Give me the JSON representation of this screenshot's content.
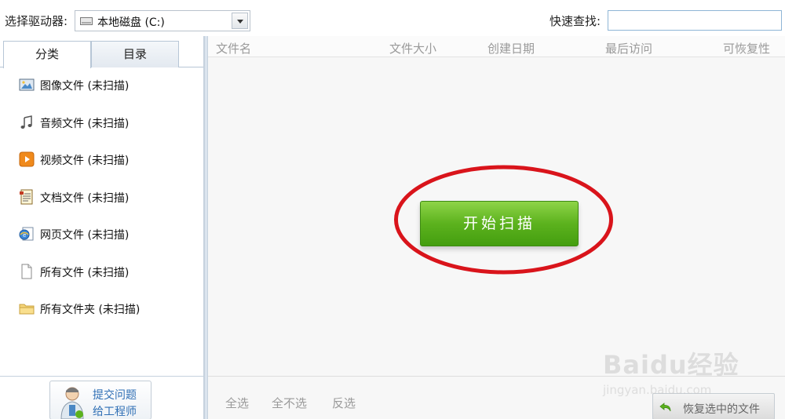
{
  "toolbar": {
    "drive_label": "选择驱动器:",
    "drive_value": "本地磁盘 (C:)",
    "search_label": "快速查找:",
    "search_value": ""
  },
  "tabs": [
    {
      "label": "分类",
      "active": true
    },
    {
      "label": "目录",
      "active": false
    }
  ],
  "categories": [
    {
      "label": "图像文件 (未扫描)",
      "icon": "image-icon"
    },
    {
      "label": "音频文件 (未扫描)",
      "icon": "music-note-icon"
    },
    {
      "label": "视频文件 (未扫描)",
      "icon": "video-play-icon"
    },
    {
      "label": "文档文件 (未扫描)",
      "icon": "document-icon"
    },
    {
      "label": "网页文件 (未扫描)",
      "icon": "web-page-icon"
    },
    {
      "label": "所有文件 (未扫描)",
      "icon": "file-icon"
    },
    {
      "label": "所有文件夹 (未扫描)",
      "icon": "folder-icon"
    }
  ],
  "support": {
    "line1": "提交问题",
    "line2": "给工程师"
  },
  "columns": {
    "name": "文件名",
    "size": "文件大小",
    "created": "创建日期",
    "last_access": "最后访问",
    "recoverability": "可恢复性"
  },
  "scan_button": "开始扫描",
  "selection": {
    "select_all": "全选",
    "select_none": "全不选",
    "invert": "反选"
  },
  "restore_button": "恢复选中的文件",
  "watermark": {
    "logo": "Baidu经验",
    "url": "jingyan.baidu.com"
  },
  "colors": {
    "scan_green": "#5cb21e",
    "highlight_red": "#d9141b",
    "link_blue": "#2f6fb5"
  }
}
